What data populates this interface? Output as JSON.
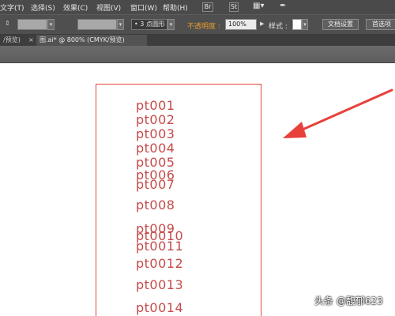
{
  "menubar": {
    "items": [
      "文字(T)",
      "选择(S)",
      "效果(C)",
      "视图(V)",
      "窗口(W)",
      "帮助(H)"
    ],
    "br_label": "Br",
    "st_label": "St",
    "grid_icon": "grid-layout-icon",
    "pen_icon": "pen-icon"
  },
  "control": {
    "stroke_profile": "3 点圆形",
    "opacity_label": "不透明度 :",
    "opacity_value": "100%",
    "style_label": "样式 :",
    "document_setup": "文档设置",
    "preferences": "首选项",
    "opacity_label_color": "#e89a2a"
  },
  "tabs": {
    "tab1": "/预览)",
    "tab2": "图.ai* @ 800% (CMYK/预览)",
    "close_glyph": "×"
  },
  "artboard": {
    "labels": [
      "pt001",
      "pt002",
      "pt003",
      "pt004",
      "pt005",
      "pt006",
      "pt007",
      "pt008",
      "pt009",
      "pt0010",
      "pt0011",
      "pt0012",
      "pt0013",
      "pt0014"
    ],
    "text_color": "#c64a4a",
    "border_color": "#e0463e"
  },
  "arrow_color": "#e8403a",
  "watermark": "头条 @馥郁623"
}
